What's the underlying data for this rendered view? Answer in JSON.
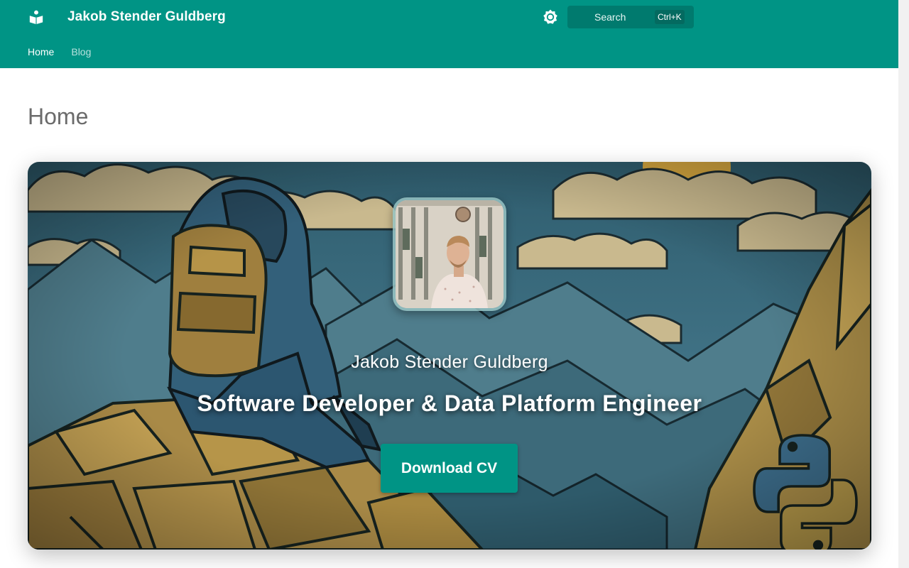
{
  "header": {
    "site_title": "Jakob Stender Guldberg",
    "logo_icon": "book-reader-icon",
    "theme_icon": "brightness-icon",
    "search": {
      "label": "Search",
      "shortcut": "Ctrl+K"
    },
    "nav": [
      {
        "label": "Home",
        "active": true
      },
      {
        "label": "Blog",
        "active": false
      }
    ],
    "color": "#009485"
  },
  "page": {
    "title": "Home"
  },
  "hero": {
    "name": "Jakob Stender Guldberg",
    "role": "Software Developer & Data Platform Engineer",
    "cta_label": "Download CV",
    "cta_color": "#009485",
    "avatar_alt": "profile-photo"
  }
}
